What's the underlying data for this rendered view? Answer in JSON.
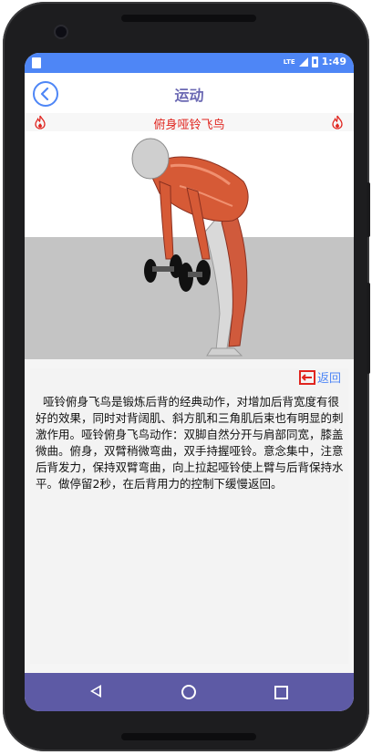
{
  "status_bar": {
    "network": "LTE",
    "time": "1:49"
  },
  "app_bar": {
    "title": "运动"
  },
  "exercise": {
    "name": "俯身哑铃飞鸟",
    "return_label": "返回",
    "description": "哑铃俯身飞鸟是锻炼后背的经典动作，对增加后背宽度有很好的效果，同时对背阔肌、斜方肌和三角肌后束也有明显的刺激作用。哑铃俯身飞鸟动作：双脚自然分开与肩部同宽，膝盖微曲。俯身，双臂稍微弯曲，双手持握哑铃。意念集中，注意后背发力，保持双臂弯曲，向上拉起哑铃使上臂与后背保持水平。做停留2秒，在后背用力的控制下缓慢返回。"
  },
  "colors": {
    "status_bar": "#4e86f6",
    "title": "#6b69b3",
    "exercise_name": "#e0251f",
    "nav_bar": "#5d5aa5"
  },
  "icons": [
    "back-circle-icon",
    "flame-icon",
    "return-arrow-icon",
    "nav-back-icon",
    "nav-home-icon",
    "nav-recent-icon"
  ]
}
